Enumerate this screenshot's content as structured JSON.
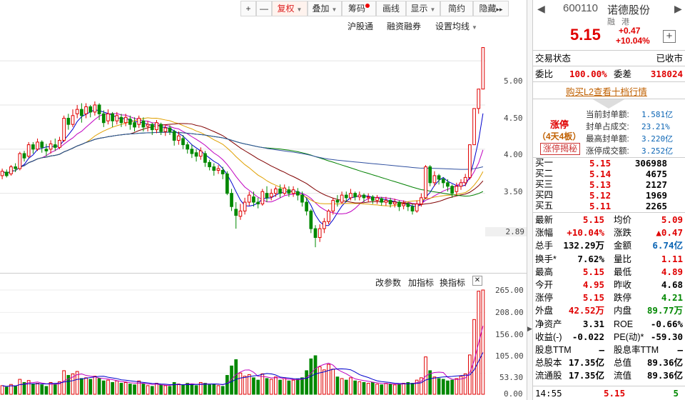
{
  "toolbar": {
    "plus": "+",
    "minus": "—",
    "fuquan": "复权",
    "diejia": "叠加",
    "chouma": "筹码",
    "huaxian": "画线",
    "xianshi": "显示",
    "jianyue": "简约",
    "yincang": "隐藏",
    "more": "▸▸"
  },
  "chart_links": {
    "hgt": "沪股通",
    "rzrq": "融资融券",
    "setma": "设置均线"
  },
  "vol_links": {
    "gaicanshu": "改参数",
    "jiazhibiao": "加指标",
    "huanzhibiao": "换指标",
    "close": "✕"
  },
  "price_axis": {
    "labels": [
      "5.00",
      "4.50",
      "4.00",
      "3.50"
    ],
    "low_marker": "2.89"
  },
  "vol_axis": {
    "labels": [
      "265.00",
      "208.00",
      "156.00",
      "105.00",
      "53.30",
      "0.00"
    ]
  },
  "colors": {
    "up": "#e00000",
    "down": "#008800",
    "ma5": "#0000cc",
    "ma10": "#c000c0",
    "ma20": "#e0a000",
    "ma30": "#800000",
    "ma60": "#008000",
    "ma120": "#3050a0"
  },
  "chart_data": {
    "type": "candlestick",
    "ylim": [
      2.6,
      5.3
    ],
    "candles": [
      [
        3.7,
        3.75,
        3.66,
        3.78
      ],
      [
        3.74,
        3.7,
        3.68,
        3.77
      ],
      [
        3.72,
        3.8,
        3.7,
        3.82
      ],
      [
        3.8,
        3.78,
        3.74,
        3.84
      ],
      [
        3.78,
        3.95,
        3.76,
        3.97
      ],
      [
        3.95,
        3.9,
        3.86,
        3.98
      ],
      [
        3.92,
        4.05,
        3.9,
        4.08
      ],
      [
        4.05,
        4.0,
        3.95,
        4.08
      ],
      [
        4.0,
        4.08,
        3.98,
        4.12
      ],
      [
        4.08,
        4.02,
        3.96,
        4.1
      ],
      [
        4.0,
        3.98,
        3.92,
        4.06
      ],
      [
        4.0,
        4.06,
        3.95,
        4.1
      ],
      [
        4.05,
        4.02,
        3.98,
        4.12
      ],
      [
        4.02,
        4.1,
        4.0,
        4.14
      ],
      [
        4.1,
        4.35,
        4.08,
        4.38
      ],
      [
        4.35,
        4.28,
        4.22,
        4.4
      ],
      [
        4.28,
        4.38,
        4.25,
        4.45
      ],
      [
        4.4,
        4.45,
        4.35,
        4.5
      ],
      [
        4.45,
        4.38,
        4.3,
        4.52
      ],
      [
        4.4,
        4.48,
        4.35,
        4.52
      ],
      [
        4.48,
        4.42,
        4.36,
        4.5
      ],
      [
        4.42,
        4.5,
        4.38,
        4.54
      ],
      [
        4.5,
        4.4,
        4.33,
        4.52
      ],
      [
        4.4,
        4.3,
        4.25,
        4.44
      ],
      [
        4.32,
        4.4,
        4.28,
        4.45
      ],
      [
        4.4,
        4.32,
        4.25,
        4.42
      ],
      [
        4.32,
        4.38,
        4.28,
        4.42
      ],
      [
        4.36,
        4.3,
        4.25,
        4.4
      ],
      [
        4.3,
        4.36,
        4.26,
        4.4
      ],
      [
        4.34,
        4.28,
        4.22,
        4.38
      ],
      [
        4.3,
        4.25,
        4.2,
        4.36
      ],
      [
        4.28,
        4.35,
        4.24,
        4.38
      ],
      [
        4.32,
        4.25,
        4.2,
        4.36
      ],
      [
        4.26,
        4.28,
        4.2,
        4.32
      ],
      [
        4.28,
        4.22,
        4.16,
        4.3
      ],
      [
        4.22,
        4.3,
        4.18,
        4.33
      ],
      [
        4.28,
        4.2,
        4.16,
        4.3
      ],
      [
        4.2,
        4.24,
        4.15,
        4.28
      ],
      [
        4.24,
        4.2,
        4.16,
        4.27
      ],
      [
        4.2,
        4.1,
        4.04,
        4.22
      ],
      [
        4.1,
        4.15,
        4.05,
        4.2
      ],
      [
        4.12,
        4.05,
        4.0,
        4.16
      ],
      [
        4.05,
        4.0,
        3.95,
        4.08
      ],
      [
        4.0,
        3.95,
        3.9,
        4.05
      ],
      [
        3.96,
        3.92,
        3.86,
        4.0
      ],
      [
        3.92,
        3.98,
        3.88,
        4.02
      ],
      [
        3.95,
        3.85,
        3.8,
        3.98
      ],
      [
        3.85,
        3.8,
        3.76,
        3.88
      ],
      [
        3.8,
        3.76,
        3.7,
        3.84
      ],
      [
        3.76,
        3.78,
        3.72,
        3.82
      ],
      [
        3.76,
        3.72,
        3.66,
        3.8
      ],
      [
        3.72,
        3.5,
        3.48,
        3.75
      ],
      [
        3.5,
        3.35,
        3.3,
        3.55
      ],
      [
        3.32,
        3.25,
        3.1,
        3.4
      ],
      [
        3.24,
        3.3,
        3.2,
        3.38
      ],
      [
        3.3,
        3.4,
        3.26,
        3.45
      ],
      [
        3.4,
        3.48,
        3.36,
        3.52
      ],
      [
        3.46,
        3.4,
        3.35,
        3.52
      ],
      [
        3.4,
        3.38,
        3.33,
        3.45
      ],
      [
        3.38,
        3.52,
        3.36,
        3.55
      ],
      [
        3.5,
        3.45,
        3.4,
        3.58
      ],
      [
        3.46,
        3.5,
        3.42,
        3.55
      ],
      [
        3.5,
        3.55,
        3.46,
        3.58
      ],
      [
        3.55,
        3.5,
        3.45,
        3.6
      ],
      [
        3.5,
        3.56,
        3.48,
        3.6
      ],
      [
        3.54,
        3.5,
        3.46,
        3.58
      ],
      [
        3.5,
        3.54,
        3.46,
        3.58
      ],
      [
        3.52,
        3.48,
        3.42,
        3.56
      ],
      [
        3.48,
        3.4,
        3.35,
        3.52
      ],
      [
        3.4,
        3.3,
        3.25,
        3.44
      ],
      [
        3.3,
        3.1,
        3.05,
        3.32
      ],
      [
        3.1,
        3.0,
        2.89,
        3.14
      ],
      [
        3.0,
        3.1,
        2.95,
        3.15
      ],
      [
        3.1,
        3.18,
        3.05,
        3.22
      ],
      [
        3.18,
        3.3,
        3.15,
        3.32
      ],
      [
        3.3,
        3.42,
        3.26,
        3.45
      ],
      [
        3.42,
        3.4,
        3.35,
        3.48
      ],
      [
        3.4,
        3.48,
        3.38,
        3.52
      ],
      [
        3.48,
        3.45,
        3.4,
        3.52
      ],
      [
        3.45,
        3.5,
        3.42,
        3.55
      ],
      [
        3.5,
        3.46,
        3.42,
        3.52
      ],
      [
        3.46,
        3.48,
        3.42,
        3.52
      ],
      [
        3.48,
        3.45,
        3.4,
        3.5
      ],
      [
        3.45,
        3.46,
        3.4,
        3.5
      ],
      [
        3.46,
        3.42,
        3.38,
        3.48
      ],
      [
        3.42,
        3.45,
        3.38,
        3.48
      ],
      [
        3.44,
        3.4,
        3.36,
        3.46
      ],
      [
        3.4,
        3.42,
        3.36,
        3.46
      ],
      [
        3.42,
        3.38,
        3.34,
        3.45
      ],
      [
        3.38,
        3.4,
        3.34,
        3.44
      ],
      [
        3.4,
        3.35,
        3.3,
        3.42
      ],
      [
        3.36,
        3.38,
        3.32,
        3.42
      ],
      [
        3.38,
        3.35,
        3.3,
        3.4
      ],
      [
        3.35,
        3.3,
        3.26,
        3.38
      ],
      [
        3.3,
        3.38,
        3.28,
        3.42
      ],
      [
        3.38,
        3.45,
        3.35,
        3.5
      ],
      [
        3.45,
        3.8,
        3.44,
        3.82
      ],
      [
        3.8,
        3.62,
        3.58,
        3.82
      ],
      [
        3.62,
        3.7,
        3.58,
        3.75
      ],
      [
        3.7,
        3.66,
        3.6,
        3.72
      ],
      [
        3.66,
        3.62,
        3.56,
        3.68
      ],
      [
        3.62,
        3.58,
        3.52,
        3.66
      ],
      [
        3.58,
        3.5,
        3.45,
        3.6
      ],
      [
        3.52,
        3.58,
        3.48,
        3.62
      ],
      [
        3.58,
        3.62,
        3.54,
        3.66
      ],
      [
        3.62,
        3.68,
        3.58,
        3.72
      ],
      [
        3.68,
        4.05,
        3.66,
        4.05
      ],
      [
        4.05,
        4.46,
        4.05,
        4.46
      ],
      [
        4.46,
        4.68,
        4.4,
        4.68
      ],
      [
        4.68,
        5.15,
        4.95,
        5.15
      ]
    ],
    "volumes": [
      22,
      18,
      25,
      20,
      38,
      30,
      35,
      26,
      28,
      24,
      20,
      30,
      26,
      32,
      60,
      48,
      52,
      58,
      40,
      42,
      38,
      46,
      40,
      34,
      36,
      30,
      34,
      28,
      30,
      26,
      24,
      34,
      26,
      22,
      20,
      28,
      24,
      22,
      20,
      30,
      26,
      24,
      28,
      26,
      22,
      30,
      28,
      24,
      26,
      22,
      20,
      48,
      72,
      88,
      54,
      46,
      50,
      42,
      36,
      52,
      40,
      38,
      44,
      36,
      40,
      34,
      36,
      38,
      42,
      60,
      90,
      98,
      70,
      62,
      76,
      64,
      44,
      40,
      36,
      42,
      34,
      32,
      30,
      28,
      30,
      26,
      24,
      28,
      26,
      24,
      26,
      28,
      30,
      28,
      36,
      42,
      95,
      60,
      44,
      40,
      38,
      34,
      36,
      40,
      46,
      52,
      100,
      190,
      262,
      265
    ]
  },
  "panel": {
    "code": "600110",
    "name": "诺德股份",
    "tags": [
      "融",
      "港"
    ],
    "price": "5.15",
    "change": "+0.47",
    "change_pct": "+10.04%",
    "add": "+",
    "trade_status_label": "交易状态",
    "trade_status": "已收市",
    "weibi_label": "委比",
    "weibi": "100.00%",
    "weicha_label": "委差",
    "weicha": "318024",
    "l2_link": "购买L2查看十档行情",
    "limit_title": "涨停",
    "limit_sub": "（4天4板）",
    "limit_btn": "涨停揭秘",
    "seal_rows": [
      {
        "label": "当前封单额:",
        "value": "1.581亿"
      },
      {
        "label": "封单占成交:",
        "value": "23.21%"
      },
      {
        "label": "最高封单额:",
        "value": "3.220亿"
      },
      {
        "label": "涨停成交额:",
        "value": "3.252亿"
      }
    ],
    "buys": [
      {
        "label": "买一",
        "price": "5.15",
        "vol": "306988"
      },
      {
        "label": "买二",
        "price": "5.14",
        "vol": "4675"
      },
      {
        "label": "买三",
        "price": "5.13",
        "vol": "2127"
      },
      {
        "label": "买四",
        "price": "5.12",
        "vol": "1969"
      },
      {
        "label": "买五",
        "price": "5.11",
        "vol": "2265"
      }
    ],
    "stats": [
      {
        "l1": "最新",
        "v1": "5.15",
        "c1": "red",
        "l2": "均价",
        "v2": "5.09",
        "c2": "red"
      },
      {
        "l1": "涨幅",
        "v1": "+10.04%",
        "c1": "red",
        "l2": "涨跌",
        "v2": "▲0.47",
        "c2": "red"
      },
      {
        "l1": "总手",
        "v1": "132.29万",
        "c1": "",
        "l2": "金额",
        "v2": "6.74亿",
        "c2": "blue"
      },
      {
        "l1": "换手*",
        "v1": "7.62%",
        "c1": "",
        "l2": "量比",
        "v2": "1.11",
        "c2": "red"
      },
      {
        "l1": "最高",
        "v1": "5.15",
        "c1": "red",
        "l2": "最低",
        "v2": "4.89",
        "c2": "red"
      },
      {
        "l1": "今开",
        "v1": "4.95",
        "c1": "red",
        "l2": "昨收",
        "v2": "4.68",
        "c2": ""
      },
      {
        "l1": "涨停",
        "v1": "5.15",
        "c1": "red",
        "l2": "跌停",
        "v2": "4.21",
        "c2": "green"
      },
      {
        "l1": "外盘",
        "v1": "42.52万",
        "c1": "red",
        "l2": "内盘",
        "v2": "89.77万",
        "c2": "green"
      },
      {
        "l1": "净资产",
        "v1": "3.31",
        "c1": "",
        "l2": "ROE",
        "v2": "-0.66%",
        "c2": ""
      },
      {
        "l1": "收益(-)",
        "v1": "-0.022",
        "c1": "",
        "l2": "PE(动)*",
        "v2": "-59.30",
        "c2": ""
      },
      {
        "l1": "股息TTM",
        "v1": "—",
        "c1": "",
        "l2": "股息率TTM",
        "v2": "—",
        "c2": ""
      },
      {
        "l1": "总股本",
        "v1": "17.35亿",
        "c1": "",
        "l2": "总值",
        "v2": "89.36亿",
        "c2": ""
      },
      {
        "l1": "流通股",
        "v1": "17.35亿",
        "c1": "",
        "l2": "流值",
        "v2": "89.36亿",
        "c2": ""
      }
    ],
    "tick": {
      "time": "14:55",
      "price": "5.15",
      "vol": "5"
    }
  }
}
